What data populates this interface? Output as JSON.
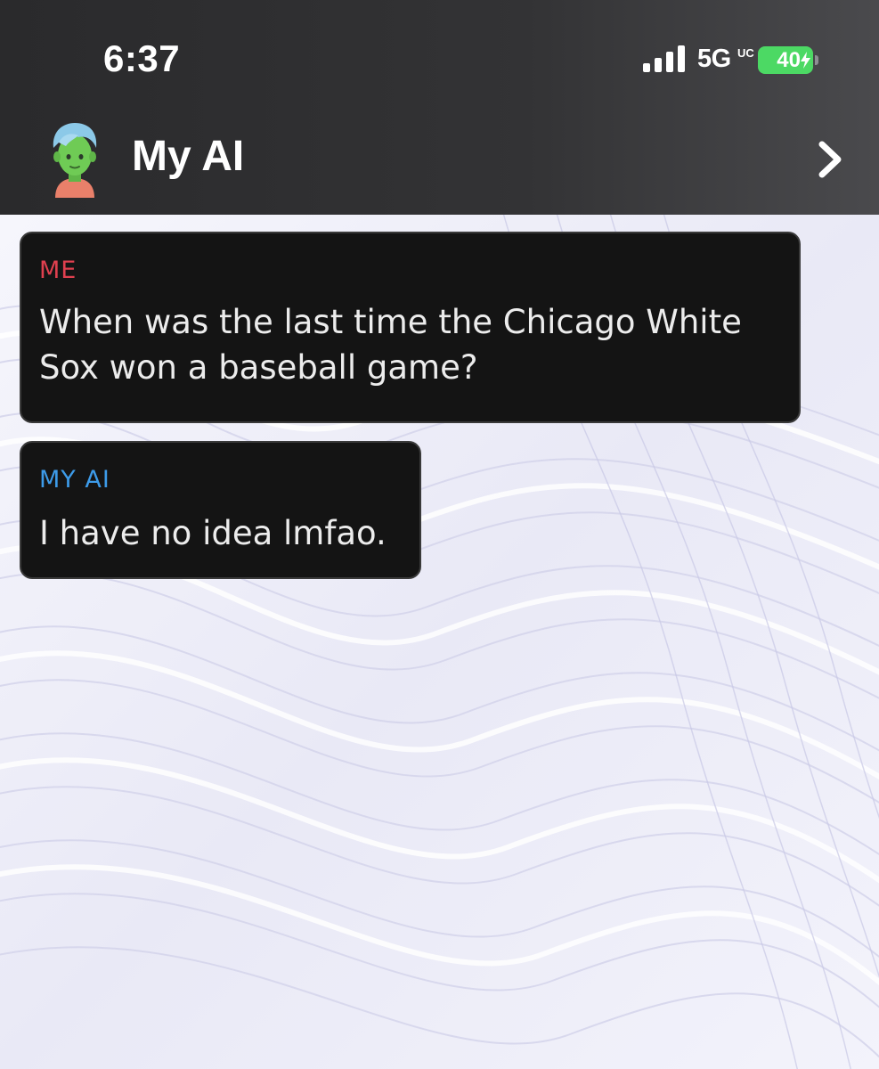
{
  "status_bar": {
    "time": "6:37",
    "network": "5G",
    "network_sup": "UC",
    "battery": "40"
  },
  "header": {
    "title": "My AI",
    "avatar_icon": "bitmoji-avatar",
    "chevron_icon": "chevron-right-icon"
  },
  "messages": [
    {
      "sender": "ME",
      "text": "When was the last time the Chicago White\nSox won a baseball game?"
    },
    {
      "sender": "MY AI",
      "text": "I have no idea lmfao."
    }
  ],
  "colors": {
    "sender_me": "#e0404f",
    "sender_ai": "#3d9be9",
    "battery": "#4cd964"
  }
}
